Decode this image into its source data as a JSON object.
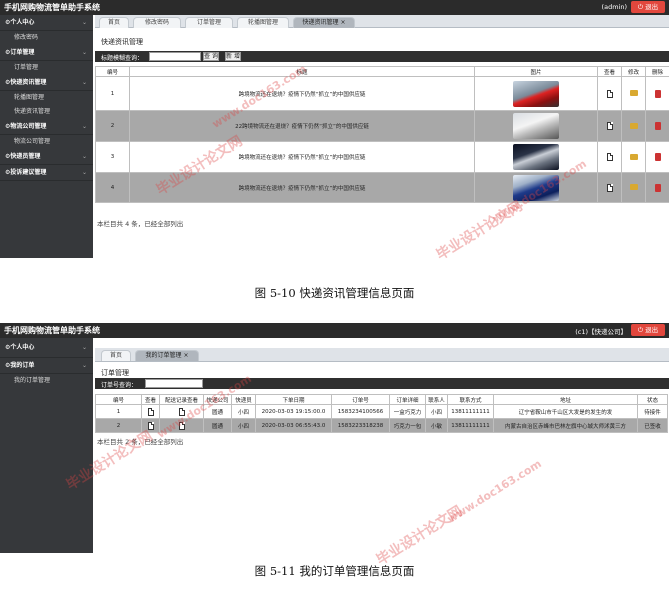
{
  "screen1": {
    "app_title": "手机网购物流管单助手系统",
    "user": "(admin)",
    "logout": "退出",
    "menu": [
      {
        "label": "个人中心",
        "items": [
          "修改密码"
        ]
      },
      {
        "label": "订单管理",
        "items": [
          "订单管理"
        ]
      },
      {
        "label": "快递资讯管理",
        "items": [
          "轮播图管理",
          "快递资讯管理"
        ]
      },
      {
        "label": "物流公司管理",
        "items": [
          "物流公司管理"
        ]
      },
      {
        "label": "快递员管理",
        "items": []
      },
      {
        "label": "投诉建议管理",
        "items": []
      }
    ],
    "tabs": [
      "首页",
      "修改密码",
      "订单管理",
      "轮播图管理",
      "快递资讯管理"
    ],
    "tab_close": "×",
    "page_title": "快递资讯管理",
    "search_label": "标题模糊查询：",
    "search_value": "",
    "search_button": "查 询",
    "add_button": "新 增",
    "columns": [
      "编号",
      "标题",
      "图片",
      "查看",
      "修改",
      "删除"
    ],
    "rows": [
      {
        "id": "1",
        "title": "跨境物流还在退烧？疫情下仍然“抓立”的中国供应链",
        "pic": "red-sports-car"
      },
      {
        "id": "2",
        "title": "22跨境物流还在退烧？疫情下仍然“抓立”的中国供应链",
        "pic": "white-sports-car"
      },
      {
        "id": "3",
        "title": "跨境物流还在退烧？疫情下仍然“抓立”的中国供应链",
        "pic": "silver-sedan"
      },
      {
        "id": "4",
        "title": "跨境物流还在退烧？疫情下仍然“抓立”的中国供应链",
        "pic": "blue-rally-car"
      }
    ],
    "footer": "本栏目共 4 条，已经全部列出"
  },
  "caption1": "图 5-10 快递资讯管理信息页面",
  "screen2": {
    "app_title": "手机网购物流管单助手系统",
    "user": "(c1)【快递公司】",
    "logout": "退出",
    "menu": [
      {
        "label": "个人中心",
        "items": []
      },
      {
        "label": "我的订单",
        "items": [
          "我的订单管理"
        ]
      }
    ],
    "tabs": [
      "首页",
      "我的订单管理"
    ],
    "tab_close": "×",
    "page_title": "订单管理",
    "search_label": "订单号查询：",
    "search_value": "",
    "columns": [
      "编号",
      "查看",
      "配送记录查看",
      "快递公司",
      "快递员",
      "下单日期",
      "订单号",
      "订单详细",
      "联系人",
      "联系方式",
      "地址",
      "状态"
    ],
    "rows": [
      [
        "1",
        "",
        "",
        "圆通",
        "小四",
        "2020-03-03 19:15:00.0",
        "1583234100566",
        "一盒巧克力",
        "小四",
        "13811111111",
        "辽宁省鞍山市千山区大发是的发生的发",
        "待接件"
      ],
      [
        "2",
        "",
        "",
        "圆通",
        "小四",
        "2020-03-03 06:55:43.0",
        "1583223318238",
        "巧克力一包",
        "小敏",
        "13811111111",
        "内蒙古自治区赤峰市巴林左旗中心城大师沭黄三方",
        "已签收"
      ]
    ],
    "footer": "本栏目共 2 条，已经全部列出"
  },
  "caption2": "图 5-11 我的订单管理信息页面",
  "watermarks": [
    "毕业设计论文网",
    "www.doc163.com"
  ],
  "colors": {
    "topbar": "#2b2b2b",
    "sidebar": "#36383b",
    "logout": "#e2473d",
    "watermark": "#dc4646"
  }
}
